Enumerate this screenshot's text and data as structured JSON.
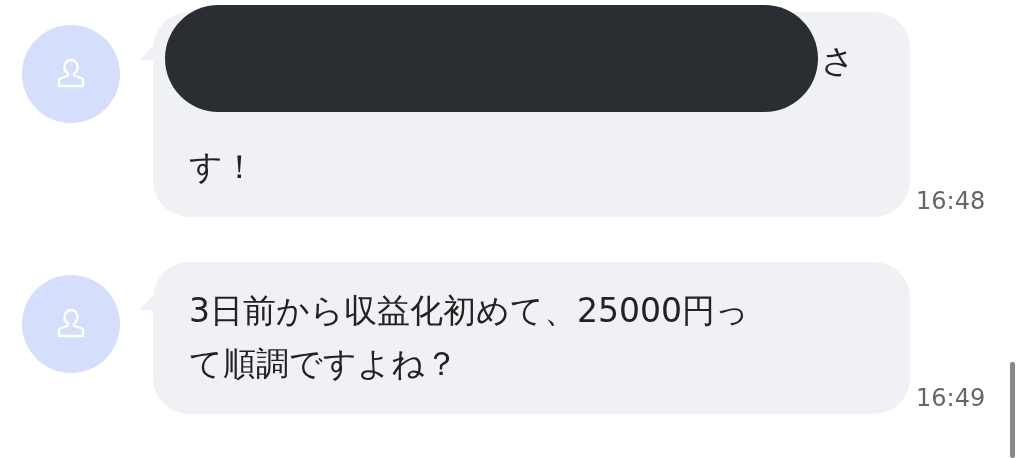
{
  "messages": [
    {
      "redacted": true,
      "lines": [
        {
          "text": "さ",
          "kind": "trailing"
        },
        {
          "text": "す！",
          "kind": "leading"
        }
      ],
      "time": "16:48"
    },
    {
      "redacted": false,
      "lines": [
        {
          "text": "3日前から収益化初めて、25000円っ",
          "kind": "leading"
        },
        {
          "text": "て順調ですよね？",
          "kind": "leading"
        }
      ],
      "time": "16:49"
    }
  ]
}
